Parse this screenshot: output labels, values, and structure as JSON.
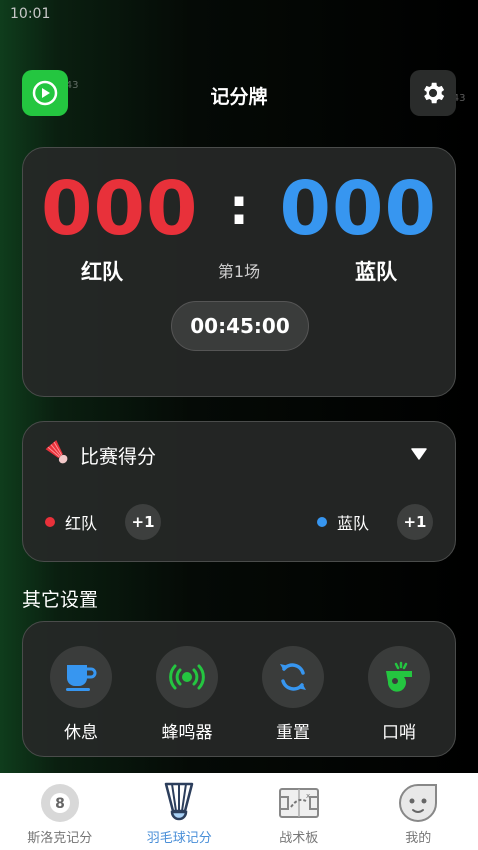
{
  "status_bar": {
    "time": "10:01"
  },
  "watermark": {
    "left": "8dee1943",
    "right": "1943"
  },
  "header": {
    "title": "记分牌"
  },
  "scoreboard": {
    "red_score": "000",
    "blue_score": "000",
    "separator": ":",
    "red_team": "红队",
    "blue_team": "蓝队",
    "round": "第1场",
    "timer": "00:45:00"
  },
  "match_score": {
    "title": "比赛得分",
    "red_team": "红队",
    "blue_team": "蓝队",
    "plus_label": "+1"
  },
  "other_settings": {
    "title": "其它设置",
    "items": [
      {
        "label": "休息",
        "icon": "cup-icon"
      },
      {
        "label": "蜂鸣器",
        "icon": "buzzer-icon"
      },
      {
        "label": "重置",
        "icon": "reset-icon"
      },
      {
        "label": "口哨",
        "icon": "whistle-icon"
      }
    ]
  },
  "tabs": [
    {
      "label": "斯洛克记分",
      "icon": "billiard-ball-icon",
      "active": false
    },
    {
      "label": "羽毛球记分",
      "icon": "shuttlecock-icon",
      "active": true
    },
    {
      "label": "战术板",
      "icon": "tactics-board-icon",
      "active": false
    },
    {
      "label": "我的",
      "icon": "profile-face-icon",
      "active": false
    }
  ],
  "colors": {
    "red": "#e8313a",
    "blue": "#3796f0",
    "green": "#24c640",
    "tab_active": "#4a8fd8"
  }
}
